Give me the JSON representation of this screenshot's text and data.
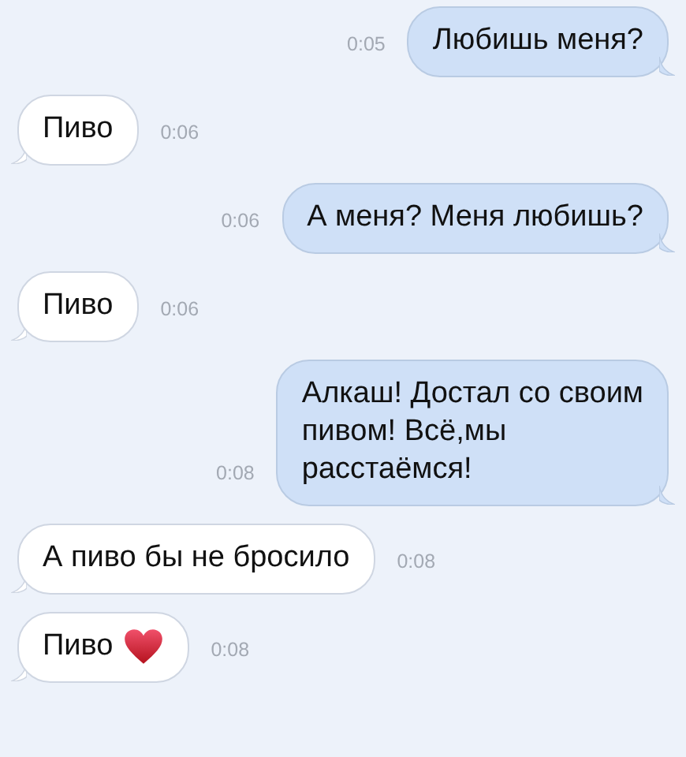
{
  "messages": [
    {
      "kind": "sent",
      "text": "Любишь меня?",
      "time": "0:05",
      "heart": false
    },
    {
      "kind": "received",
      "text": "Пиво",
      "time": "0:06",
      "heart": false
    },
    {
      "kind": "sent",
      "text": "А меня? Меня любишь?",
      "time": "0:06",
      "heart": false
    },
    {
      "kind": "received",
      "text": "Пиво",
      "time": "0:06",
      "heart": false
    },
    {
      "kind": "sent",
      "text": "Алкаш! Достал со своим\nпивом! Всё,мы\nрасстаёмся!",
      "time": "0:08",
      "heart": false
    },
    {
      "kind": "received",
      "text": "А пиво бы не бросило",
      "time": "0:08",
      "heart": false
    },
    {
      "kind": "received",
      "text": "Пиво",
      "time": "0:08",
      "heart": true
    }
  ]
}
